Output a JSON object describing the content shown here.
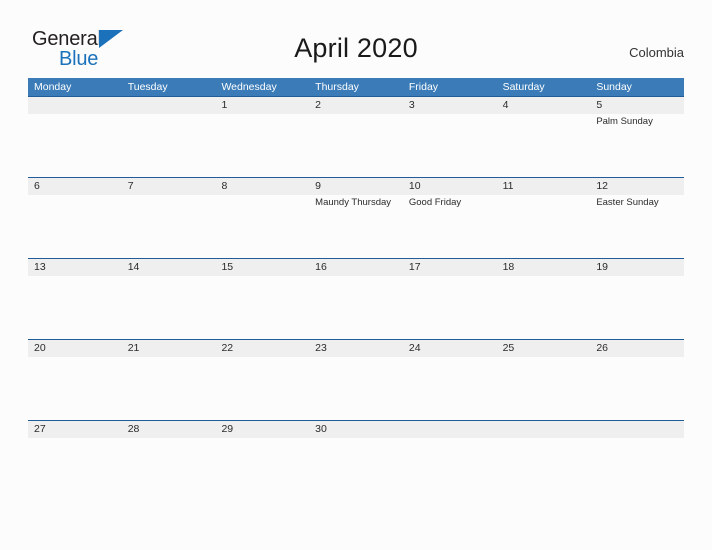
{
  "brand": {
    "name_part1": "General",
    "name_part2": "Blue",
    "triangle_icon": "blue-triangle-icon",
    "color_dark": "#231f20",
    "color_blue": "#1c72ba"
  },
  "header": {
    "title": "April 2020",
    "region": "Colombia"
  },
  "calendar": {
    "accent_header_color": "#3b7cb8",
    "row_divider_color": "#1f5c99",
    "date_band_color": "#efefef",
    "weekday_headers": [
      "Monday",
      "Tuesday",
      "Wednesday",
      "Thursday",
      "Friday",
      "Saturday",
      "Sunday"
    ],
    "weeks": [
      [
        {
          "day": "",
          "event": ""
        },
        {
          "day": "",
          "event": ""
        },
        {
          "day": "1",
          "event": ""
        },
        {
          "day": "2",
          "event": ""
        },
        {
          "day": "3",
          "event": ""
        },
        {
          "day": "4",
          "event": ""
        },
        {
          "day": "5",
          "event": "Palm Sunday"
        }
      ],
      [
        {
          "day": "6",
          "event": ""
        },
        {
          "day": "7",
          "event": ""
        },
        {
          "day": "8",
          "event": ""
        },
        {
          "day": "9",
          "event": "Maundy Thursday"
        },
        {
          "day": "10",
          "event": "Good Friday"
        },
        {
          "day": "11",
          "event": ""
        },
        {
          "day": "12",
          "event": "Easter Sunday"
        }
      ],
      [
        {
          "day": "13",
          "event": ""
        },
        {
          "day": "14",
          "event": ""
        },
        {
          "day": "15",
          "event": ""
        },
        {
          "day": "16",
          "event": ""
        },
        {
          "day": "17",
          "event": ""
        },
        {
          "day": "18",
          "event": ""
        },
        {
          "day": "19",
          "event": ""
        }
      ],
      [
        {
          "day": "20",
          "event": ""
        },
        {
          "day": "21",
          "event": ""
        },
        {
          "day": "22",
          "event": ""
        },
        {
          "day": "23",
          "event": ""
        },
        {
          "day": "24",
          "event": ""
        },
        {
          "day": "25",
          "event": ""
        },
        {
          "day": "26",
          "event": ""
        }
      ],
      [
        {
          "day": "27",
          "event": ""
        },
        {
          "day": "28",
          "event": ""
        },
        {
          "day": "29",
          "event": ""
        },
        {
          "day": "30",
          "event": ""
        },
        {
          "day": "",
          "event": ""
        },
        {
          "day": "",
          "event": ""
        },
        {
          "day": "",
          "event": ""
        }
      ]
    ]
  }
}
